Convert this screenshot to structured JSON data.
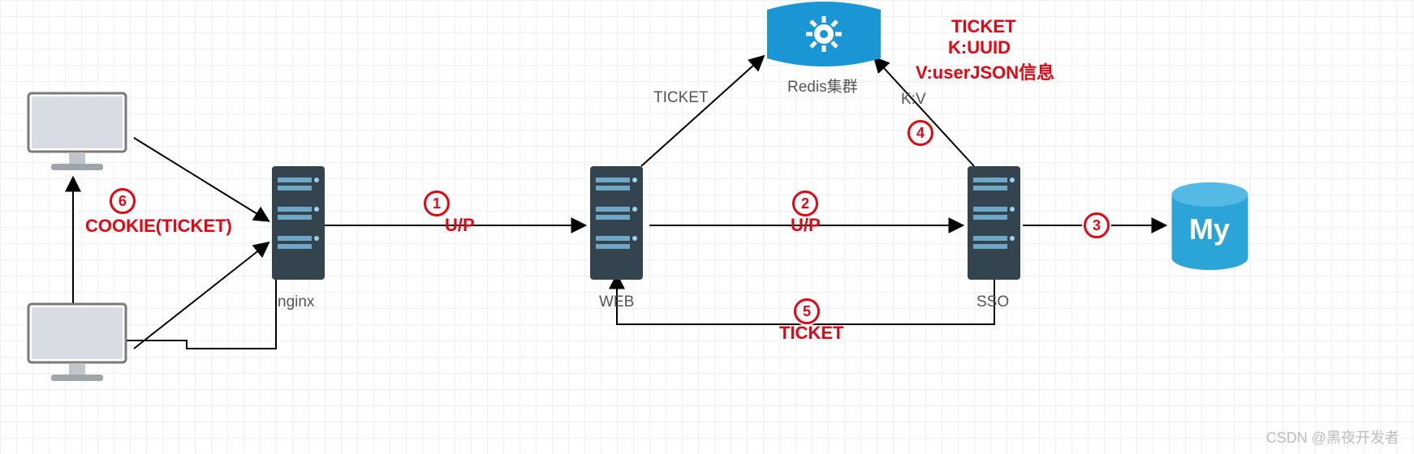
{
  "nodes": {
    "nginx": "nginx",
    "web": "WEB",
    "sso": "SSO",
    "redis": "Redis集群",
    "mysql": "My"
  },
  "edges": {
    "e1_label": "U/P",
    "e2_label": "U/P",
    "e4_label": "K:V",
    "e5_label": "TICKET",
    "e6_label": "COOKIE(TICKET)",
    "ticket_to_redis": "TICKET"
  },
  "annotations": {
    "redis_info_line1": "TICKET",
    "redis_info_line2": "K:UUID",
    "redis_info_line3": "V:userJSON信息"
  },
  "badges": {
    "b1": "1",
    "b2": "2",
    "b3": "3",
    "b4": "4",
    "b5": "5",
    "b6": "6"
  },
  "watermark": "CSDN @黑夜开发者"
}
